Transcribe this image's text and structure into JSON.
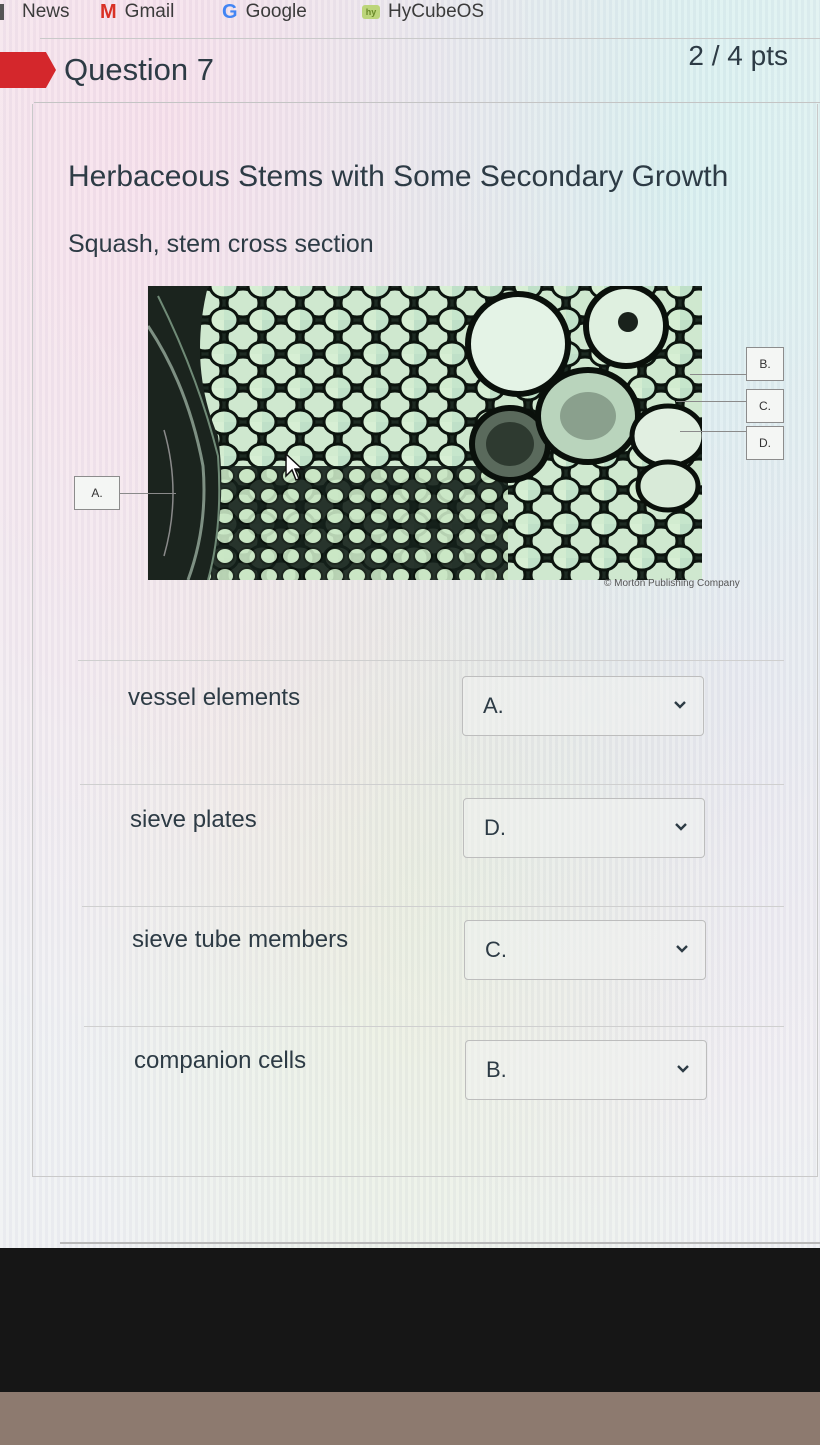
{
  "bookmarks": [
    {
      "label": "News",
      "icon": "news-icon"
    },
    {
      "label": "Gmail",
      "icon": "gmail-icon"
    },
    {
      "label": "Google",
      "icon": "google-icon"
    },
    {
      "label": "HyCubeOS",
      "icon": "hycube-icon"
    }
  ],
  "question": {
    "title": "Question 7",
    "points": "2 / 4 pts",
    "heading": "Herbaceous Stems with Some Secondary Growth",
    "subheading": "Squash, stem cross section",
    "figure": {
      "credit": "© Morton Publishing Company",
      "labels": [
        "A.",
        "B.",
        "C.",
        "D."
      ]
    },
    "matches": [
      {
        "term": "vessel elements",
        "selected": "A."
      },
      {
        "term": "sieve plates",
        "selected": "D."
      },
      {
        "term": "sieve tube members",
        "selected": "C."
      },
      {
        "term": "companion cells",
        "selected": "B."
      }
    ]
  },
  "colors": {
    "accent_flag": "#d4272c",
    "text": "#2d3b45"
  }
}
